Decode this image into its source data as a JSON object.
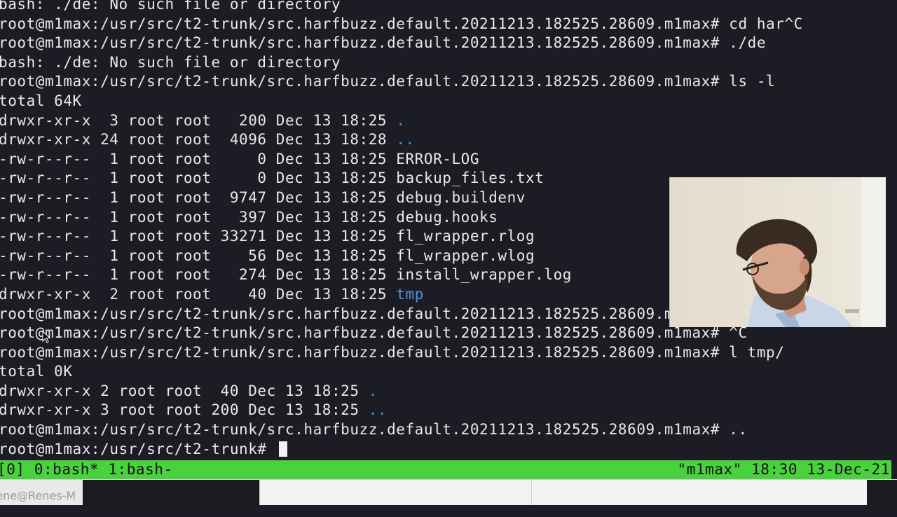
{
  "terminal": {
    "lines": [
      {
        "parts": [
          {
            "text": "bash: ./de: No such file or directory"
          }
        ]
      },
      {
        "parts": [
          {
            "text": "root@m1max:/usr/src/t2-trunk/src.harfbuzz.default.20211213.182525.28609.m1max# cd har^C"
          }
        ]
      },
      {
        "parts": [
          {
            "text": "root@m1max:/usr/src/t2-trunk/src.harfbuzz.default.20211213.182525.28609.m1max# ./de"
          }
        ]
      },
      {
        "parts": [
          {
            "text": "bash: ./de: No such file or directory"
          }
        ]
      },
      {
        "parts": [
          {
            "text": "root@m1max:/usr/src/t2-trunk/src.harfbuzz.default.20211213.182525.28609.m1max# ls -l"
          }
        ]
      },
      {
        "parts": [
          {
            "text": "total 64K"
          }
        ]
      },
      {
        "parts": [
          {
            "text": "drwxr-xr-x  3 root root   200 Dec 13 18:25 "
          },
          {
            "text": ".",
            "blue": true
          }
        ]
      },
      {
        "parts": [
          {
            "text": "drwxr-xr-x 24 root root  4096 Dec 13 18:28 "
          },
          {
            "text": "..",
            "blue": true
          }
        ]
      },
      {
        "parts": [
          {
            "text": "-rw-r--r--  1 root root     0 Dec 13 18:25 ERROR-LOG"
          }
        ]
      },
      {
        "parts": [
          {
            "text": "-rw-r--r--  1 root root     0 Dec 13 18:25 backup_files.txt"
          }
        ]
      },
      {
        "parts": [
          {
            "text": "-rw-r--r--  1 root root  9747 Dec 13 18:25 debug.buildenv"
          }
        ]
      },
      {
        "parts": [
          {
            "text": "-rw-r--r--  1 root root   397 Dec 13 18:25 debug.hooks"
          }
        ]
      },
      {
        "parts": [
          {
            "text": "-rw-r--r--  1 root root 33271 Dec 13 18:25 fl_wrapper.rlog"
          }
        ]
      },
      {
        "parts": [
          {
            "text": "-rw-r--r--  1 root root    56 Dec 13 18:25 fl_wrapper.wlog"
          }
        ]
      },
      {
        "parts": [
          {
            "text": "-rw-r--r--  1 root root   274 Dec 13 18:25 install_wrapper.log"
          }
        ]
      },
      {
        "parts": [
          {
            "text": "drwxr-xr-x  2 root root    40 Dec 13 18:25 "
          },
          {
            "text": "tmp",
            "blue": true
          }
        ]
      },
      {
        "parts": [
          {
            "text": "root@m1max:/usr/src/t2-trunk/src.harfbuzz.default.20211213.182525.28609.m"
          }
        ]
      },
      {
        "parts": [
          {
            "text": "root@m1max:/usr/src/t2-trunk/src.harfbuzz.default.20211213.182525.28609.m1max# ^C"
          }
        ]
      },
      {
        "parts": [
          {
            "text": "root@m1max:/usr/src/t2-trunk/src.harfbuzz.default.20211213.182525.28609.m1max# l tmp/"
          }
        ]
      },
      {
        "parts": [
          {
            "text": "total 0K"
          }
        ]
      },
      {
        "parts": [
          {
            "text": "drwxr-xr-x 2 root root  40 Dec 13 18:25 "
          },
          {
            "text": ".",
            "blue": true
          }
        ]
      },
      {
        "parts": [
          {
            "text": "drwxr-xr-x 3 root root 200 Dec 13 18:25 "
          },
          {
            "text": "..",
            "blue": true
          }
        ]
      },
      {
        "parts": [
          {
            "text": "root@m1max:/usr/src/t2-trunk/src.harfbuzz.default.20211213.182525.28609.m1max# .."
          }
        ]
      },
      {
        "parts": [
          {
            "text": "root@m1max:/usr/src/t2-trunk# "
          }
        ],
        "cursor": true
      }
    ]
  },
  "statusbar": {
    "left": "[0] 0:bash* 1:bash-",
    "right": "\"m1max\" 18:30 13-Dec-21"
  },
  "taskbar": {
    "left_label": "rene@Renes-M"
  },
  "colors": {
    "background": "#1c1d24",
    "text": "#e9e9ec",
    "directory": "#4f8fde",
    "statusbar": "#4ad13e"
  }
}
